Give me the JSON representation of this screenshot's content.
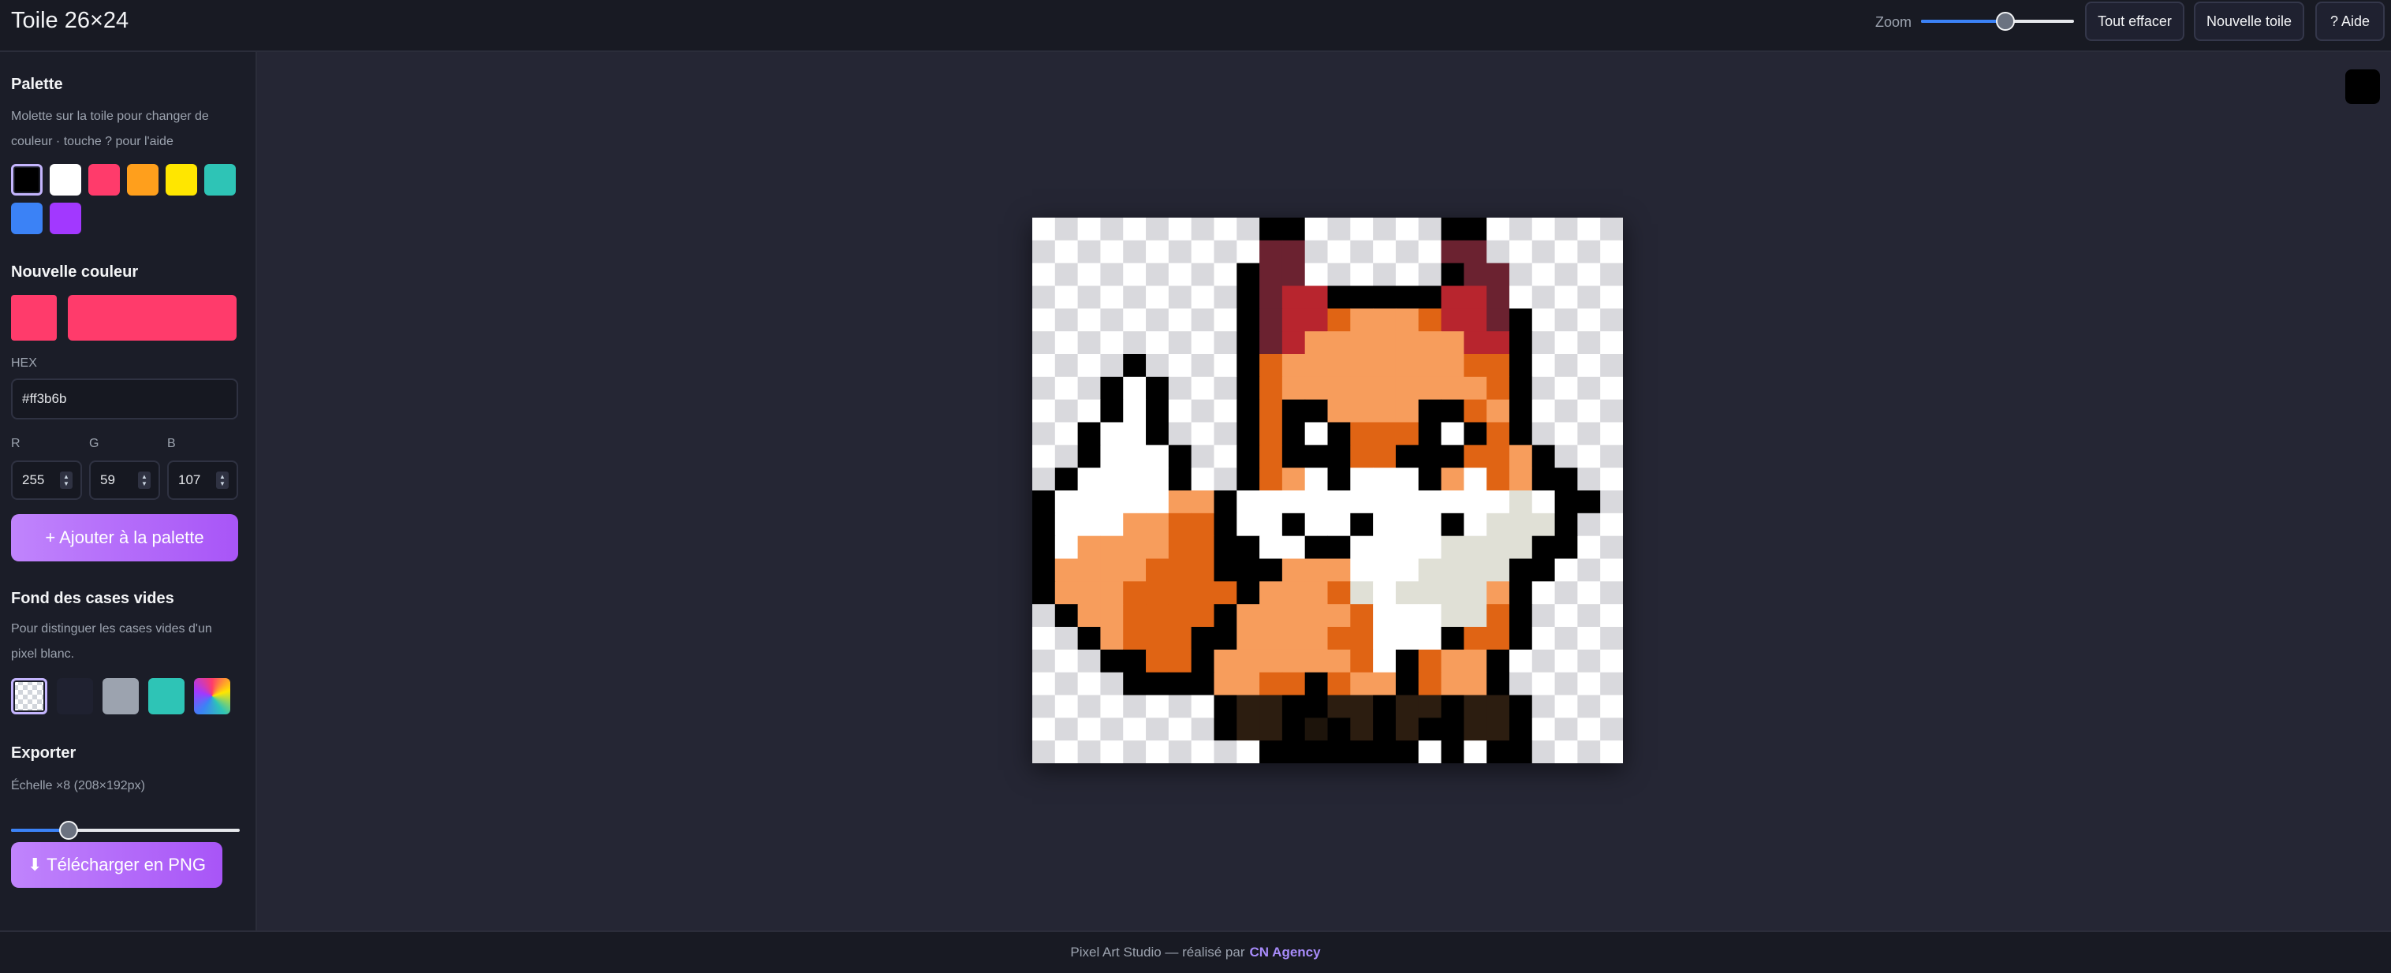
{
  "header": {
    "title": "Toile 26×24",
    "zoom_label": "Zoom",
    "zoom_value": 0.55,
    "clear_label": "Tout effacer",
    "new_canvas_label": "Nouvelle toile",
    "help_label": "? Aide"
  },
  "sidebar": {
    "palette_title": "Palette",
    "palette_hint": "Molette sur la toile pour changer de couleur · touche ? pour l'aide",
    "palette": [
      "#000000",
      "#ffffff",
      "#ff3b6b",
      "#ff9f1c",
      "#ffe600",
      "#2ec4b6",
      "#3b82f6",
      "#a238ff"
    ],
    "selected_palette_index": 0,
    "new_color_title": "Nouvelle couleur",
    "new_color": "#ff3b6b",
    "hex_label": "HEX",
    "hex_value": "#ff3b6b",
    "r_label": "R",
    "r_value": "255",
    "g_label": "G",
    "g_value": "59",
    "b_label": "B",
    "b_value": "107",
    "add_button_label": "+ Ajouter à la palette",
    "bg_title": "Fond des cases vides",
    "bg_hint": "Pour distinguer les cases vides d'un pixel blanc.",
    "bg_options": [
      "checker",
      "#1f2130",
      "#9ca3af",
      "#2ec4b6",
      "rainbow"
    ],
    "selected_bg_index": 0,
    "export_title": "Exporter",
    "export_scale_label": "Échelle ×8 (208×192px)",
    "export_scale_value": 0.25,
    "download_label": "⬇ Télécharger en PNG"
  },
  "canvas": {
    "columns": 26,
    "rows": 24,
    "checker_light": "#ffffff",
    "checker_dark": "#d9d9dd",
    "colors": {
      "K": "#000000",
      "W": "#ffffff",
      "O": "#f79d5c",
      "D": "#e06414",
      "M": "#6b2230",
      "R": "#b8252e",
      "B": "#2c1d10",
      "N": "#1d140b",
      "G": "#e0e0d6"
    },
    "pixels": [
      "..........KK......KK......",
      "..........MM......MM......",
      ".........KMM......KMM.....",
      ".........KMRRKKKKKRRM.....",
      ".........KMRRDOOODRRMK....",
      ".........KMROOOOOOORRK....",
      "....K....KDOOOOOOOODDK....",
      "...KWK...KDOOOOOOOOODK....",
      "...KWK...KDKKOOOOKKDOKW...",
      "..KWWK...KDKWKDDDKWKDK....",
      "..KWWWK..KDKKKDDKKKDDOK...",
      ".KWWWWK..KDOWKWWWKOWDOKK..",
      "KWWWWWOOKWWWWWWWWWWWWGWKK.",
      "KWWWOODDKWWKWWKWWWKWGGGK..",
      "KWOOOODDKKWWKKWWWWGGGGKK..",
      "KOOOODDDKKKOOOWWWGGGGKK...",
      "KOOODDDDDKOOODGWGGGGOK....",
      ".KOODDDDKOOOOODWWWGGDK....",
      "..KODDDKKOOOODDWWWKDDK....",
      "...KKDDKOOOOOODWKDOOK.....",
      "....KKKKOODDKDOOKDOOK.....",
      "........KBBKKBBKBBKBBK....",
      "........KBBKNKBKBKKBBK....",
      "..........KKKKKKK.K.KK...."
    ]
  },
  "footer": {
    "text": "Pixel Art Studio — réalisé par",
    "link": "CN Agency"
  }
}
